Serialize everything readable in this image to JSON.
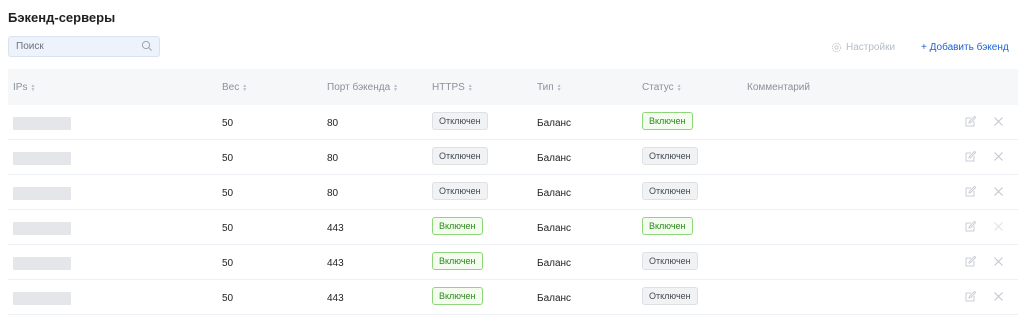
{
  "title": "Бэкенд-серверы",
  "search": {
    "placeholder": "Поиск"
  },
  "toolbar": {
    "settings_label": "Настройки",
    "add_label": "+ Добавить бэкенд"
  },
  "table": {
    "columns": {
      "ips": "IPs",
      "weight": "Вес",
      "port": "Порт бэкенда",
      "https": "HTTPS",
      "type": "Тип",
      "status": "Статус",
      "comment": "Комментарий"
    },
    "rows": [
      {
        "ip": "",
        "weight": "50",
        "port": "80",
        "https": "Отключен",
        "https_on": false,
        "type": "Баланс",
        "status": "Включен",
        "status_on": true,
        "comment": ""
      },
      {
        "ip": "",
        "weight": "50",
        "port": "80",
        "https": "Отключен",
        "https_on": false,
        "type": "Баланс",
        "status": "Отключен",
        "status_on": false,
        "comment": ""
      },
      {
        "ip": "",
        "weight": "50",
        "port": "80",
        "https": "Отключен",
        "https_on": false,
        "type": "Баланс",
        "status": "Отключен",
        "status_on": false,
        "comment": ""
      },
      {
        "ip": "",
        "weight": "50",
        "port": "443",
        "https": "Включен",
        "https_on": true,
        "type": "Баланс",
        "status": "Включен",
        "status_on": true,
        "comment": ""
      },
      {
        "ip": "",
        "weight": "50",
        "port": "443",
        "https": "Включен",
        "https_on": true,
        "type": "Баланс",
        "status": "Отключен",
        "status_on": false,
        "comment": ""
      },
      {
        "ip": "",
        "weight": "50",
        "port": "443",
        "https": "Включен",
        "https_on": true,
        "type": "Баланс",
        "status": "Отключен",
        "status_on": false,
        "comment": ""
      }
    ],
    "row_icons": [
      "edit-icon",
      "close-icon"
    ]
  },
  "colors": {
    "accent": "#1a63d6",
    "tag_on": "#2b8a1c",
    "tag_on_border": "#8fd67a",
    "tag_off_border": "#dde0e5",
    "header_bg": "#f6f7f9"
  }
}
